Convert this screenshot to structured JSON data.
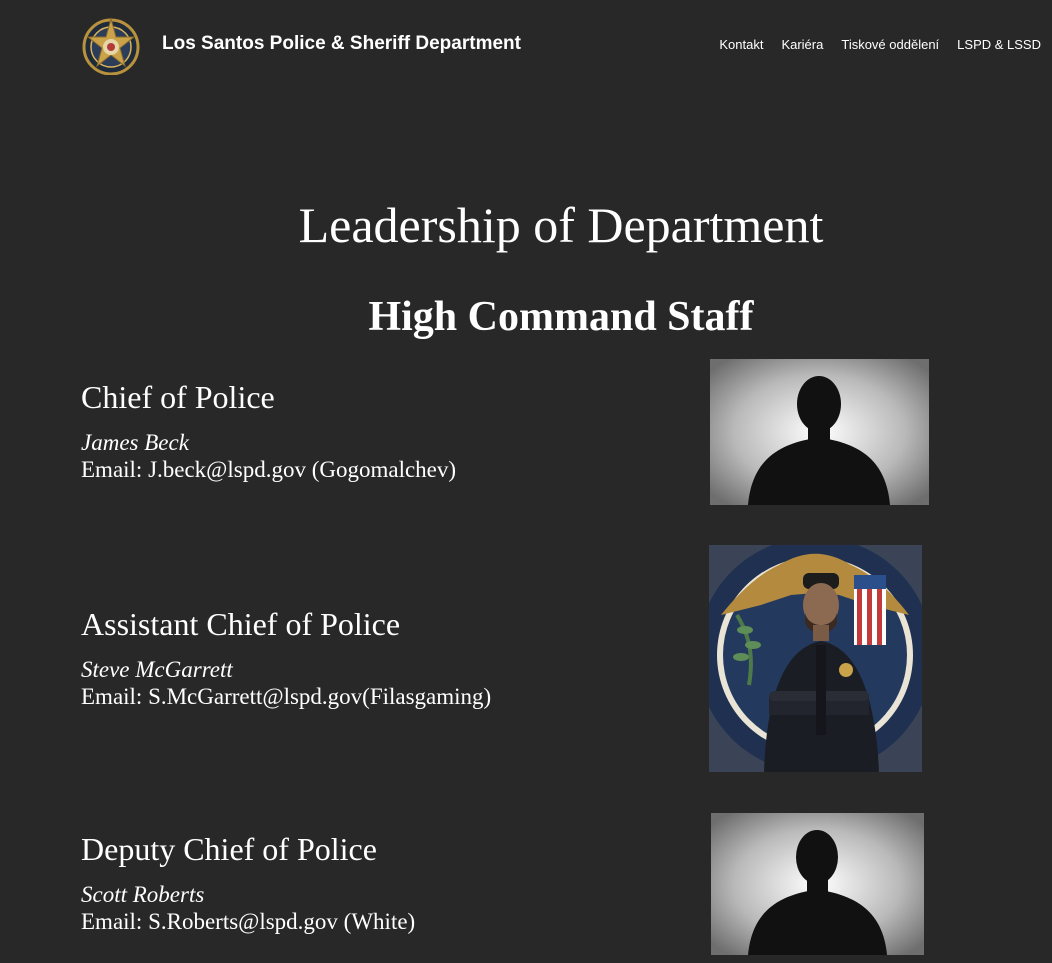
{
  "header": {
    "site_title": "Los Santos Police & Sheriff Department",
    "nav": [
      "Kontakt",
      "Kariéra",
      "Tiskové oddělení",
      "LSPD & LSSD"
    ]
  },
  "main": {
    "page_heading": "Leadership of Department",
    "section_heading": "High Command Staff",
    "staff": [
      {
        "rank": "Chief of Police",
        "name": "James Beck",
        "email": "Email: J.beck@lspd.gov (Gogomalchev)"
      },
      {
        "rank": "Assistant Chief of Police",
        "name": "Steve McGarrett",
        "email": "Email: S.McGarrett@lspd.gov(Filasgaming)"
      },
      {
        "rank": "Deputy Chief of Police",
        "name": "Scott Roberts",
        "email": "Email: S.Roberts@lspd.gov (White)"
      }
    ]
  }
}
